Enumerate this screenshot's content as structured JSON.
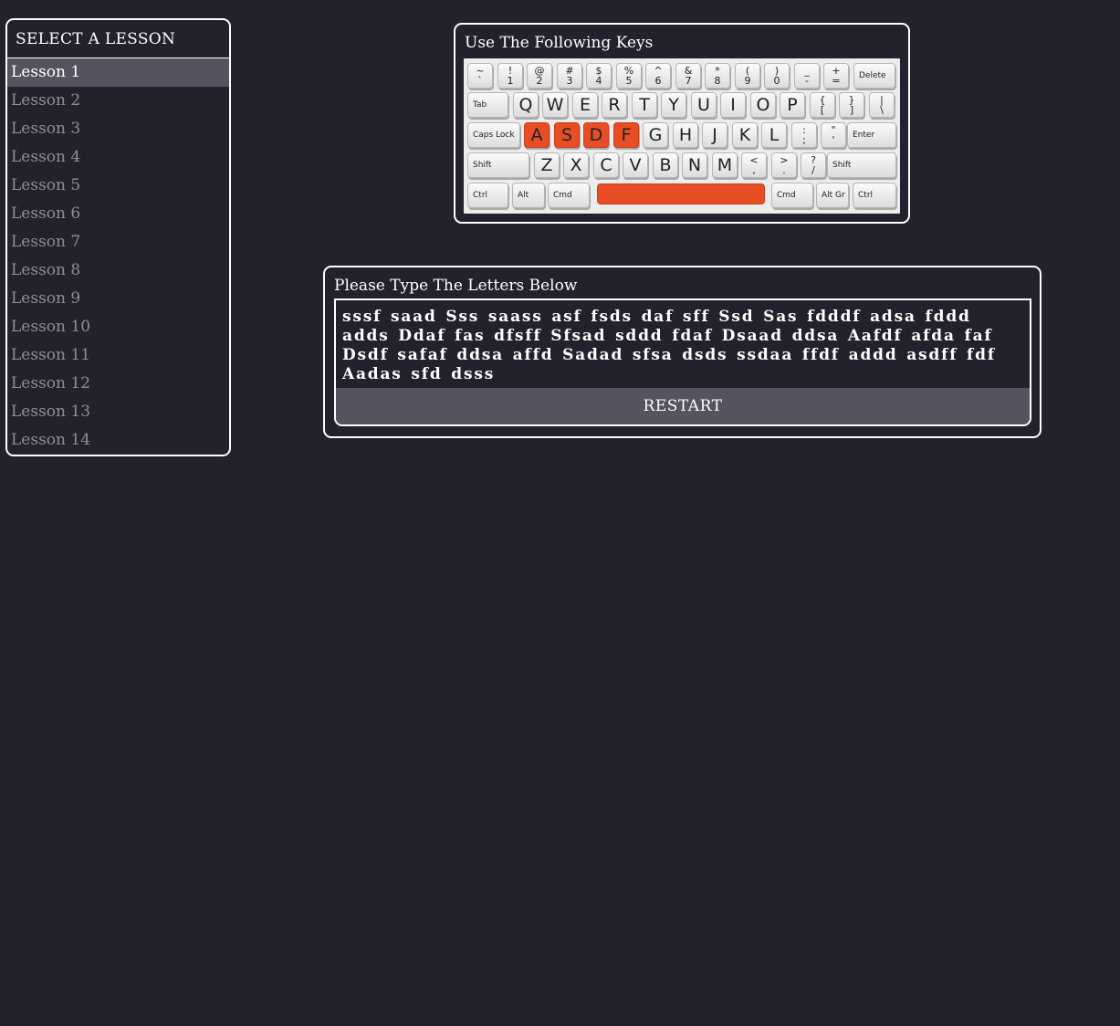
{
  "sidebar": {
    "title": "SELECT A LESSON",
    "items": [
      {
        "label": "Lesson 1",
        "active": true
      },
      {
        "label": "Lesson 2"
      },
      {
        "label": "Lesson 3"
      },
      {
        "label": "Lesson 4"
      },
      {
        "label": "Lesson 5"
      },
      {
        "label": "Lesson 6"
      },
      {
        "label": "Lesson 7"
      },
      {
        "label": "Lesson 8"
      },
      {
        "label": "Lesson 9"
      },
      {
        "label": "Lesson 10"
      },
      {
        "label": "Lesson 11"
      },
      {
        "label": "Lesson 12"
      },
      {
        "label": "Lesson 13"
      },
      {
        "label": "Lesson 14"
      }
    ]
  },
  "keys_panel": {
    "title": "Use The Following Keys",
    "highlight_color": "#e84e26",
    "highlighted_keys": [
      "A",
      "S",
      "D",
      "F",
      "Space"
    ],
    "rows": [
      [
        [
          "~",
          "`"
        ],
        [
          "!",
          "1"
        ],
        [
          "@",
          "2"
        ],
        [
          "#",
          "3"
        ],
        [
          "$",
          "4"
        ],
        [
          "%",
          "5"
        ],
        [
          "^",
          "6"
        ],
        [
          "&",
          "7"
        ],
        [
          "*",
          "8"
        ],
        [
          "(",
          "9"
        ],
        [
          ")",
          "0"
        ],
        [
          "_",
          "-"
        ],
        [
          "+",
          "="
        ],
        "Delete"
      ],
      [
        "Tab",
        "Q",
        "W",
        "E",
        "R",
        "T",
        "Y",
        "U",
        "I",
        "O",
        "P",
        [
          "{",
          "["
        ],
        [
          "}",
          "]"
        ],
        [
          "|",
          "\\"
        ]
      ],
      [
        "Caps Lock",
        "A",
        "S",
        "D",
        "F",
        "G",
        "H",
        "J",
        "K",
        "L",
        [
          ":",
          ";"
        ],
        [
          "\"",
          "'"
        ],
        "Enter"
      ],
      [
        "Shift",
        "Z",
        "X",
        "C",
        "V",
        "B",
        "N",
        "M",
        [
          "<",
          ","
        ],
        [
          ">",
          "."
        ],
        [
          "?",
          "/"
        ],
        "Shift"
      ],
      [
        "Ctrl",
        "Alt",
        "Cmd",
        "",
        "Cmd",
        "Alt Gr",
        "Ctrl"
      ]
    ]
  },
  "typing": {
    "title": "Please Type The Letters Below",
    "text": "sssf saad Sss saass asf fsds daf sff Ssd Sas fdddf adsa fddd adds Ddaf fas dfsff Sfsad sddd fdaf Dsaad ddsa Aafdf afda faf Dsdf safaf ddsa affd Sadad sfsa dsds ssdaa ffdf addd asdff fdf Aadas sfd dsss",
    "restart_label": "RESTART"
  }
}
